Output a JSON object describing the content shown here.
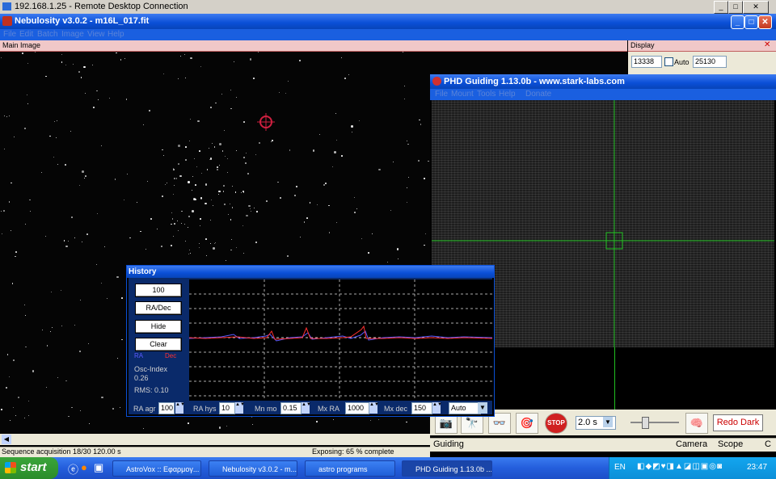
{
  "rdp": {
    "title": "192.168.1.25 - Remote Desktop Connection"
  },
  "nebulosity": {
    "title": "Nebulosity v3.0.2 - m16L_017.fit",
    "menu": [
      "File",
      "Edit",
      "Batch",
      "Image",
      "View",
      "Help"
    ],
    "main_panel_label": "Main Image",
    "display_panel_label": "Display",
    "display_low": "13338",
    "display_high": "25130",
    "auto_label": "Auto"
  },
  "phd": {
    "title": "PHD Guiding 1.13.0b  -  www.stark-labs.com",
    "menu": [
      "File",
      "Mount",
      "Tools",
      "Help",
      "Donate"
    ],
    "exposure_value": "2.0 s",
    "redo_dark_label": "Redo Dark",
    "status_left": "Guiding",
    "status_right": [
      "Camera",
      "Scope",
      "C"
    ]
  },
  "history": {
    "title": "History",
    "btn_scale": "100",
    "btn_radec": "RA/Dec",
    "btn_hide": "Hide",
    "btn_clear": "Clear",
    "legend_ra": "RA",
    "legend_dec": "Dec",
    "osc_label": "Osc-Index",
    "osc_value": "0.26",
    "rms_label": "RMS: 0.10",
    "controls": {
      "ra_agr_label": "RA agr",
      "ra_agr_value": "100",
      "ra_hys_label": "RA hys",
      "ra_hys_value": "10",
      "mn_mo_label": "Mn mo",
      "mn_mo_value": "0.15",
      "mx_ra_label": "Mx RA",
      "mx_ra_value": "1000",
      "mx_dec_label": "Mx dec",
      "mx_dec_value": "150",
      "dec_mode_value": "Auto"
    },
    "colors": {
      "ra": "#5a5aff",
      "dec": "#ff3030",
      "grid": "#aaaaaa"
    }
  },
  "status": {
    "left": "Sequence acquisition 18/30  120.00 s",
    "center": "Exposing: 65 % complete"
  },
  "taskbar": {
    "start_label": "start",
    "tasks": [
      "AstroVox :: Εφαρμογ...",
      "Nebulosity v3.0.2 - m...",
      "astro programs",
      "PHD Guiding 1.13.0b ..."
    ],
    "language": "EN",
    "clock": "23:47"
  }
}
